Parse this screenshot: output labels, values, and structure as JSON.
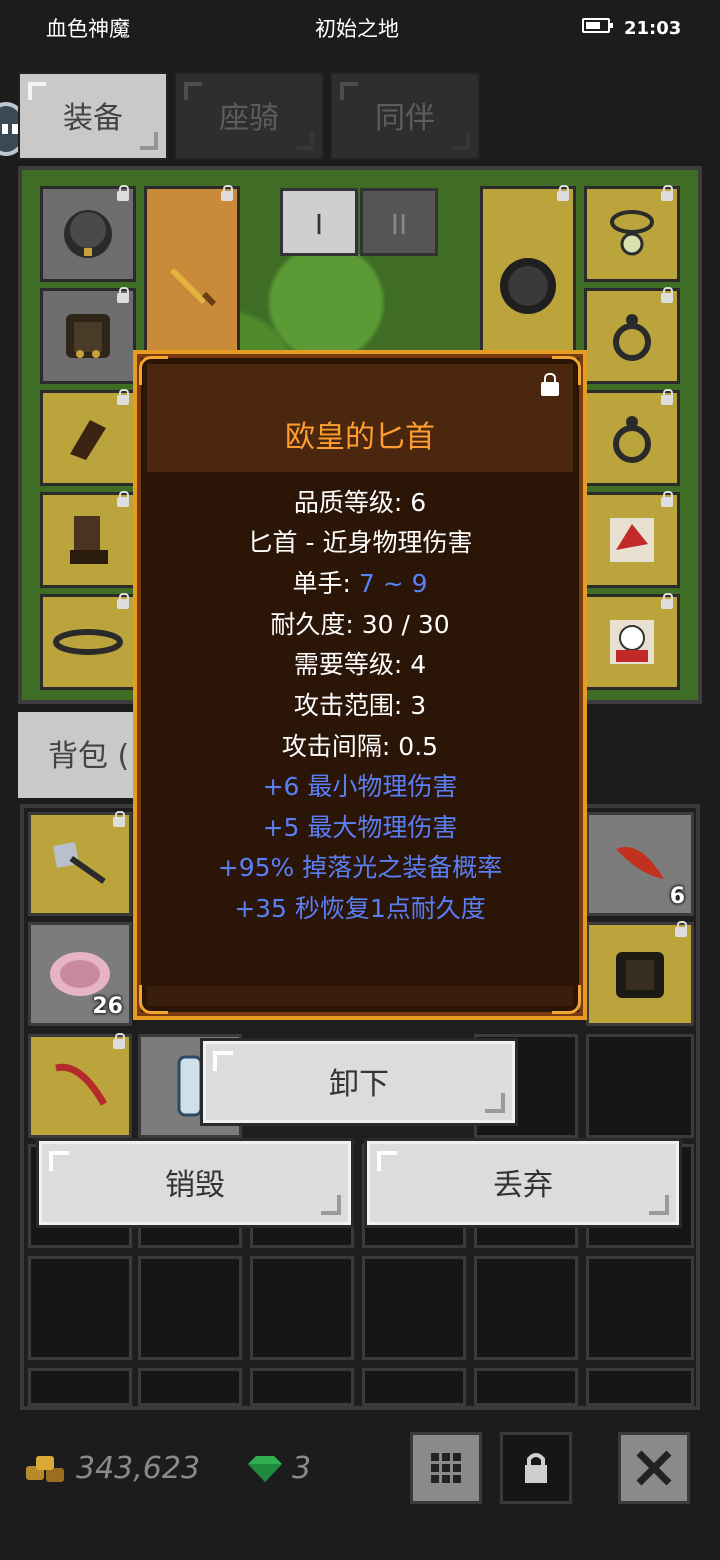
{
  "status_bar": {
    "left": "血色神魔",
    "center": "初始之地",
    "time": "21:03"
  },
  "tabs": [
    {
      "label": "装备",
      "active": true
    },
    {
      "label": "座骑",
      "active": false
    },
    {
      "label": "同伴",
      "active": false
    }
  ],
  "equipment": {
    "set_buttons": [
      "I",
      "II"
    ]
  },
  "backpack": {
    "tab_label": "背包 (",
    "counts": [
      "6",
      "26"
    ]
  },
  "tooltip": {
    "title": "欧皇的匕首",
    "lines": [
      {
        "text": "品质等级: 6"
      },
      {
        "text": "匕首 - 近身物理伤害"
      },
      {
        "prefix": "单手: ",
        "value": "7 ~ 9"
      },
      {
        "text": "耐久度: 30 / 30"
      },
      {
        "text": "需要等级: 4"
      },
      {
        "text": "攻击范围: 3"
      },
      {
        "text": "攻击间隔: 0.5"
      },
      {
        "text": "+6 最小物理伤害",
        "color": "blue"
      },
      {
        "text": "+5 最大物理伤害",
        "color": "blue"
      },
      {
        "text": "+95% 掉落光之装备概率",
        "color": "blue"
      },
      {
        "text": "+35 秒恢复1点耐久度",
        "color": "blue"
      }
    ],
    "title_color": "#ff9d2e",
    "stat_blue": "#5a7ff5"
  },
  "actions": {
    "unequip": "卸下",
    "destroy": "销毁",
    "discard": "丢弃"
  },
  "currency": {
    "gold": "343,623",
    "gems": "3"
  },
  "bottom_icons": [
    "grid-icon",
    "lock-icon",
    "close-icon"
  ]
}
